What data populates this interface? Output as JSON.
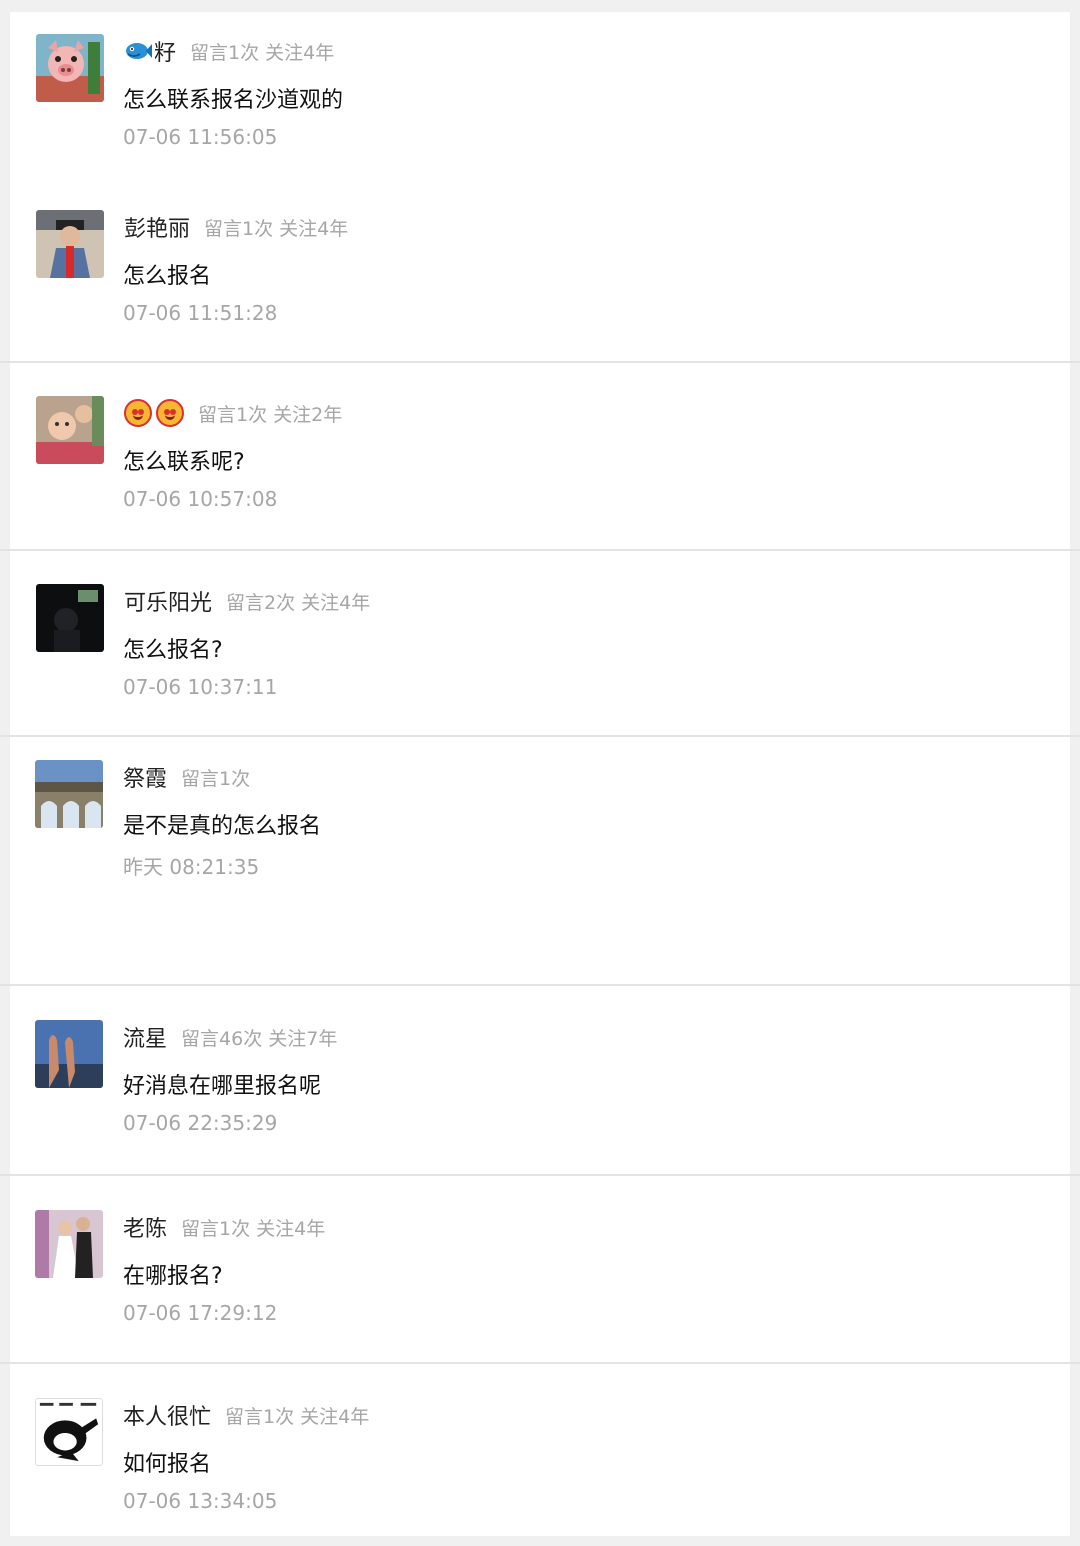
{
  "comments": [
    {
      "name": "籽",
      "name_prefix_icon": "blue-fish-icon",
      "stats": "留言1次 关注4年",
      "text": "怎么联系报名沙道观的",
      "time": "07-06 11:56:05",
      "avatar_icon": "cartoon-pig-avatar"
    },
    {
      "name": "彭艳丽",
      "stats": "留言1次 关注4年",
      "text": "怎么报名",
      "time": "07-06 11:51:28",
      "avatar_icon": "person-photo-avatar"
    },
    {
      "name": "",
      "name_emoji_icons": [
        "smiling-devil-emoji-icon",
        "smiling-devil-emoji-icon"
      ],
      "stats": "留言1次 关注2年",
      "text": "怎么联系呢?",
      "time": "07-06 10:57:08",
      "avatar_icon": "baby-photo-avatar"
    },
    {
      "name": "可乐阳光",
      "stats": "留言2次 关注4年",
      "text": "怎么报名?",
      "time": "07-06 10:37:11",
      "avatar_icon": "dark-photo-avatar"
    },
    {
      "name": "祭霞",
      "stats": "留言1次",
      "text": "是不是真的怎么报名",
      "time": "昨天 08:21:35",
      "avatar_icon": "landscape-bridge-avatar"
    },
    {
      "name": "流星",
      "stats": "留言46次 关注7年",
      "text": "好消息在哪里报名呢",
      "time": "07-06 22:35:29",
      "avatar_icon": "victory-hand-avatar"
    },
    {
      "name": "老陈",
      "stats": "留言1次 关注4年",
      "text": "在哪报名?",
      "time": "07-06 17:29:12",
      "avatar_icon": "wedding-photo-avatar"
    },
    {
      "name": "本人很忙",
      "stats": "留言1次 关注4年",
      "text": "如何报名",
      "time": "07-06 13:34:05",
      "avatar_icon": "meme-face-avatar"
    }
  ],
  "colors": {
    "background": "#f0f0f0",
    "panel": "#ffffff",
    "divider": "#e3e3e3",
    "name": "#222222",
    "muted": "#a6a6a6",
    "text": "#111111"
  }
}
